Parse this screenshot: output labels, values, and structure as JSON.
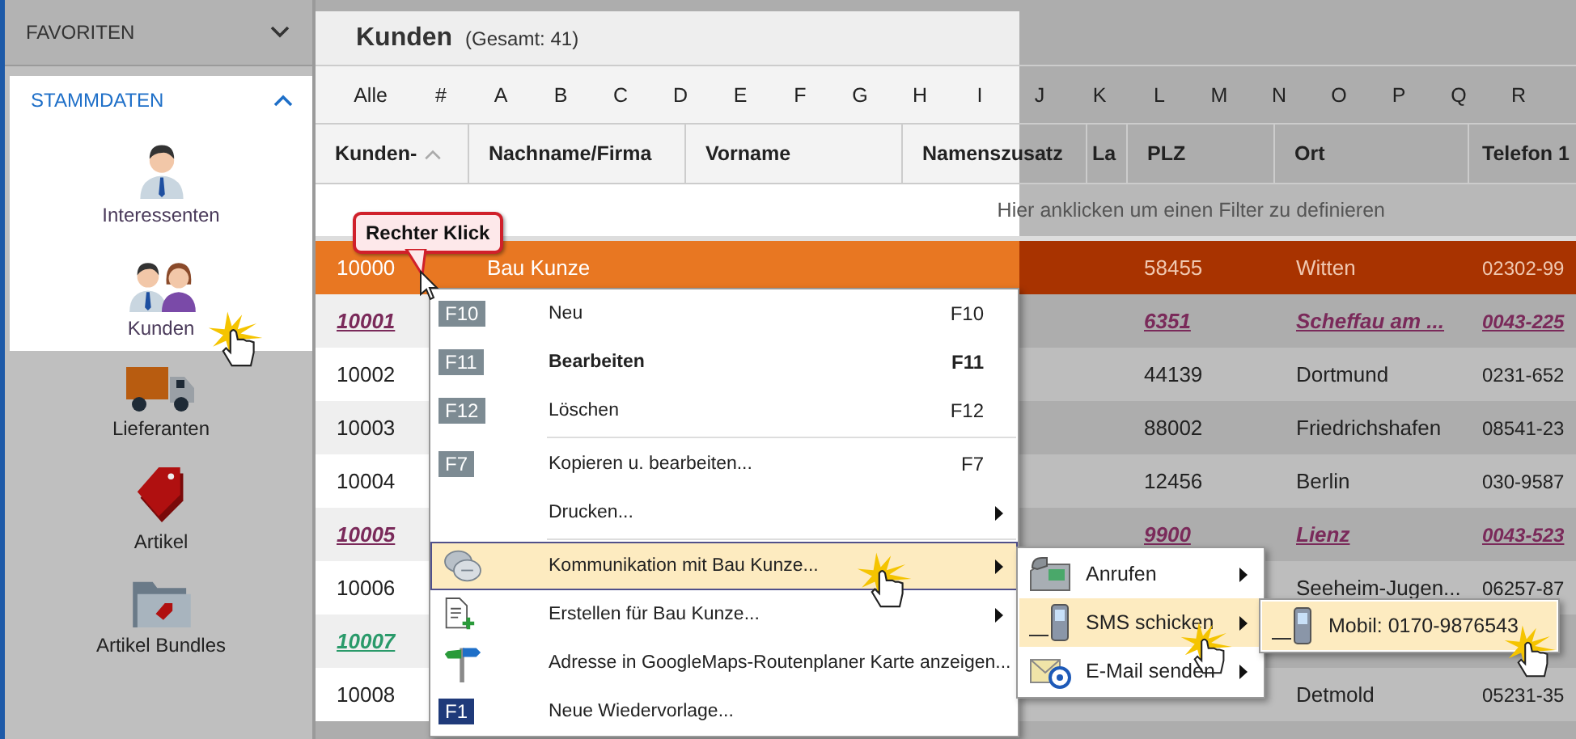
{
  "sidebar": {
    "favorites": {
      "title": "FAVORITEN",
      "expanded": false
    },
    "stammdaten": {
      "title": "STAMMDATEN",
      "expanded": true,
      "highlighted": true,
      "items": [
        {
          "label": "Interessenten",
          "kind": "person",
          "highlighted": true,
          "clicked": false
        },
        {
          "label": "Kunden",
          "kind": "people",
          "highlighted": true,
          "clicked": true
        },
        {
          "label": "Lieferanten",
          "kind": "truck",
          "highlighted": false,
          "clicked": false
        },
        {
          "label": "Artikel",
          "kind": "tag",
          "highlighted": false,
          "clicked": false
        },
        {
          "label": "Artikel Bundles",
          "kind": "folder",
          "highlighted": false,
          "clicked": false
        }
      ]
    }
  },
  "list": {
    "title": "Kunden",
    "total": "(Gesamt: 41)",
    "letters": [
      "Alle",
      "#",
      "A",
      "B",
      "C",
      "D",
      "E",
      "F",
      "G",
      "H",
      "I",
      "J",
      "K",
      "L",
      "M",
      "N",
      "O",
      "P",
      "Q",
      "R"
    ],
    "columns": [
      {
        "label": "Kunden-",
        "sorted": true
      },
      {
        "label": "Nachname/Firma",
        "sorted": false
      },
      {
        "label": "Vorname",
        "sorted": false
      },
      {
        "label": "Namenszusatz",
        "sorted": false
      },
      {
        "label": "La",
        "sorted": false
      },
      {
        "label": "PLZ",
        "sorted": false
      },
      {
        "label": "Ort",
        "sorted": false
      },
      {
        "label": "Telefon 1",
        "sorted": false
      }
    ],
    "filter_hint": "Hier anklicken um einen Filter zu definieren",
    "rows": [
      {
        "nr": "10000",
        "name": "Bau Kunze",
        "plz": "58455",
        "ort": "Witten",
        "telefon": "02302-99",
        "selected": true,
        "kind": "plain"
      },
      {
        "nr": "10001",
        "plz": "6351",
        "ort": "Scheffau am ...",
        "telefon": "0043-225",
        "selected": false,
        "kind": "link",
        "color": "#7a2a5a"
      },
      {
        "nr": "10002",
        "plz": "44139",
        "ort": "Dortmund",
        "telefon": "0231-652",
        "selected": false,
        "kind": "plain"
      },
      {
        "nr": "10003",
        "plz": "88002",
        "ort": "Friedrichshafen",
        "telefon": "08541-23",
        "selected": false,
        "kind": "plain"
      },
      {
        "nr": "10004",
        "plz": "12456",
        "ort": "Berlin",
        "telefon": "030-9587",
        "selected": false,
        "kind": "plain"
      },
      {
        "nr": "10005",
        "plz": "9900",
        "ort": "Lienz",
        "telefon": "0043-523",
        "selected": false,
        "kind": "link",
        "color": "#7a2a5a"
      },
      {
        "nr": "10006",
        "ort": "Seeheim-Jugen...",
        "telefon": "06257-87",
        "selected": false,
        "kind": "plain"
      },
      {
        "nr": "10007",
        "selected": false,
        "kind": "link",
        "color": "#2a9a6a"
      },
      {
        "nr": "10008",
        "ort": "Detmold",
        "telefon": "05231-35",
        "selected": false,
        "kind": "plain"
      }
    ]
  },
  "annotation": {
    "text": "Rechter Klick"
  },
  "context_menu": {
    "items": [
      {
        "kind": "shortcut",
        "badge": "F10",
        "label": "Neu",
        "shortcut": "F10",
        "bold": false,
        "has_submenu": false,
        "selected": false,
        "clicked": false
      },
      {
        "kind": "shortcut",
        "badge": "F11",
        "label": "Bearbeiten",
        "shortcut": "F11",
        "bold": true,
        "has_submenu": false,
        "selected": false,
        "clicked": false
      },
      {
        "kind": "shortcut",
        "badge": "F12",
        "label": "Löschen",
        "shortcut": "F12",
        "bold": false,
        "has_submenu": false,
        "selected": false,
        "clicked": false
      },
      {
        "kind": "separator"
      },
      {
        "kind": "shortcut",
        "badge": "F7",
        "label": "Kopieren u. bearbeiten...",
        "shortcut": "F7",
        "bold": false,
        "has_submenu": false,
        "selected": false,
        "clicked": false
      },
      {
        "kind": "plain",
        "label": "Drucken...",
        "bold": false,
        "has_submenu": true,
        "selected": false,
        "clicked": false
      },
      {
        "kind": "separator"
      },
      {
        "kind": "chat",
        "label": "Kommunikation mit Bau Kunze...",
        "bold": false,
        "has_submenu": true,
        "selected": true,
        "clicked": true
      },
      {
        "kind": "document",
        "label": "Erstellen für Bau Kunze...",
        "bold": false,
        "has_submenu": true,
        "selected": false,
        "clicked": false
      },
      {
        "kind": "signpost",
        "label": "Adresse in GoogleMaps-Routenplaner Karte anzeigen...",
        "bold": false,
        "has_submenu": false,
        "selected": false,
        "clicked": false
      },
      {
        "kind": "reminder",
        "badge": "F1",
        "label": "Neue Wiedervorlage...",
        "bold": false,
        "has_submenu": false,
        "selected": false,
        "clicked": false
      }
    ]
  },
  "communication_menu": {
    "items": [
      {
        "kind": "phone",
        "label": "Anrufen",
        "has_submenu": true,
        "selected": false,
        "clicked": false
      },
      {
        "kind": "mobile",
        "label": "SMS schicken",
        "has_submenu": true,
        "selected": true,
        "clicked": true
      },
      {
        "kind": "mail",
        "label": "E-Mail senden",
        "has_submenu": true,
        "selected": false,
        "clicked": false
      }
    ]
  },
  "sms_menu": {
    "items": [
      {
        "kind": "mobile",
        "label": "Mobil: 0170-9876543",
        "has_submenu": false,
        "selected": true,
        "clicked": true
      }
    ]
  }
}
